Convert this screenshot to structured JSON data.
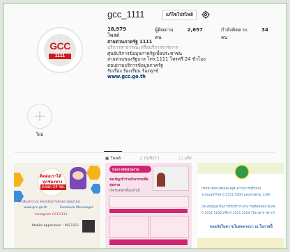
{
  "profile": {
    "username": "gcc_1111",
    "edit_button": "แก้ไขโปรไฟล์",
    "logo_text": "GCC",
    "logo_number": "1111"
  },
  "stats": {
    "posts_count": "18,979",
    "posts_label": "โพสต์",
    "followers_label": "ผู้ติดตาม",
    "followers_count": "2,657",
    "followers_unit": "คน",
    "following_label": "กำลังติดตาม",
    "following_count": "34",
    "following_unit": "คน"
  },
  "bio": {
    "name": "สายด่วนภาครัฐ 1111",
    "category": "บริการสาธารณะหรือบริการราชการ",
    "line1": "ศูนย์บริการข้อมูลภาครัฐเพื่อประชาชน",
    "line2": "สายด่วนของรัฐบาล โทร.1111 โทรฟรี 24 ชั่วโมง",
    "line3": "ตอบถามบริการข้อมูลภาครัฐ",
    "line4": "รับเรื่อง ร้องเรียน ร้องทุกข์",
    "link": "www.gcc.go.th"
  },
  "highlight": {
    "label": "ใหม่"
  },
  "tabs": [
    {
      "label": "โพสต์"
    },
    {
      "label": "บันทึกไว้"
    },
    {
      "label": "แท็ก"
    }
  ],
  "posts": {
    "p1": {
      "title": "ติดต่อเราได้",
      "subtitle": "ทุกช่องทาง",
      "hours": "ตลอด 24 ชม.",
      "line1": "ทางอีเมล์ Chat ตอบกลับผ่านช่องทางออนไลน์",
      "web": "www.gcc.go.th",
      "fb": "Facebook Messenger",
      "ig": "Instagram GCC1111",
      "app": "Mobile Application : PSC1111"
    },
    "p2": {
      "title": "ประกาศหน่วยงาน",
      "line1": "ขอเชิญเข้าร่วมกิจกรรมเพื่อสุขภาพ",
      "line2": "เปิดรับสมัครตั้งแต่วันนี้"
    },
    "p3": {
      "line1": "กรมทางหลวงชนบท อยู่ระหว่างการปรับปรุง",
      "line2": "ระบบเบอร์โทร 0 2551 5000 และสายด่วน 1146",
      "line3": "ประสบปัญหาในการให้บริการ สามารถติดต่อหมายเลข",
      "line4": "0 2551 5200 หรือ 0 2551 5204 (ในเวลาราชการ)",
      "line5": "ขออภัยในความไม่สะดวกมา ณ โอกาสนี้"
    }
  }
}
